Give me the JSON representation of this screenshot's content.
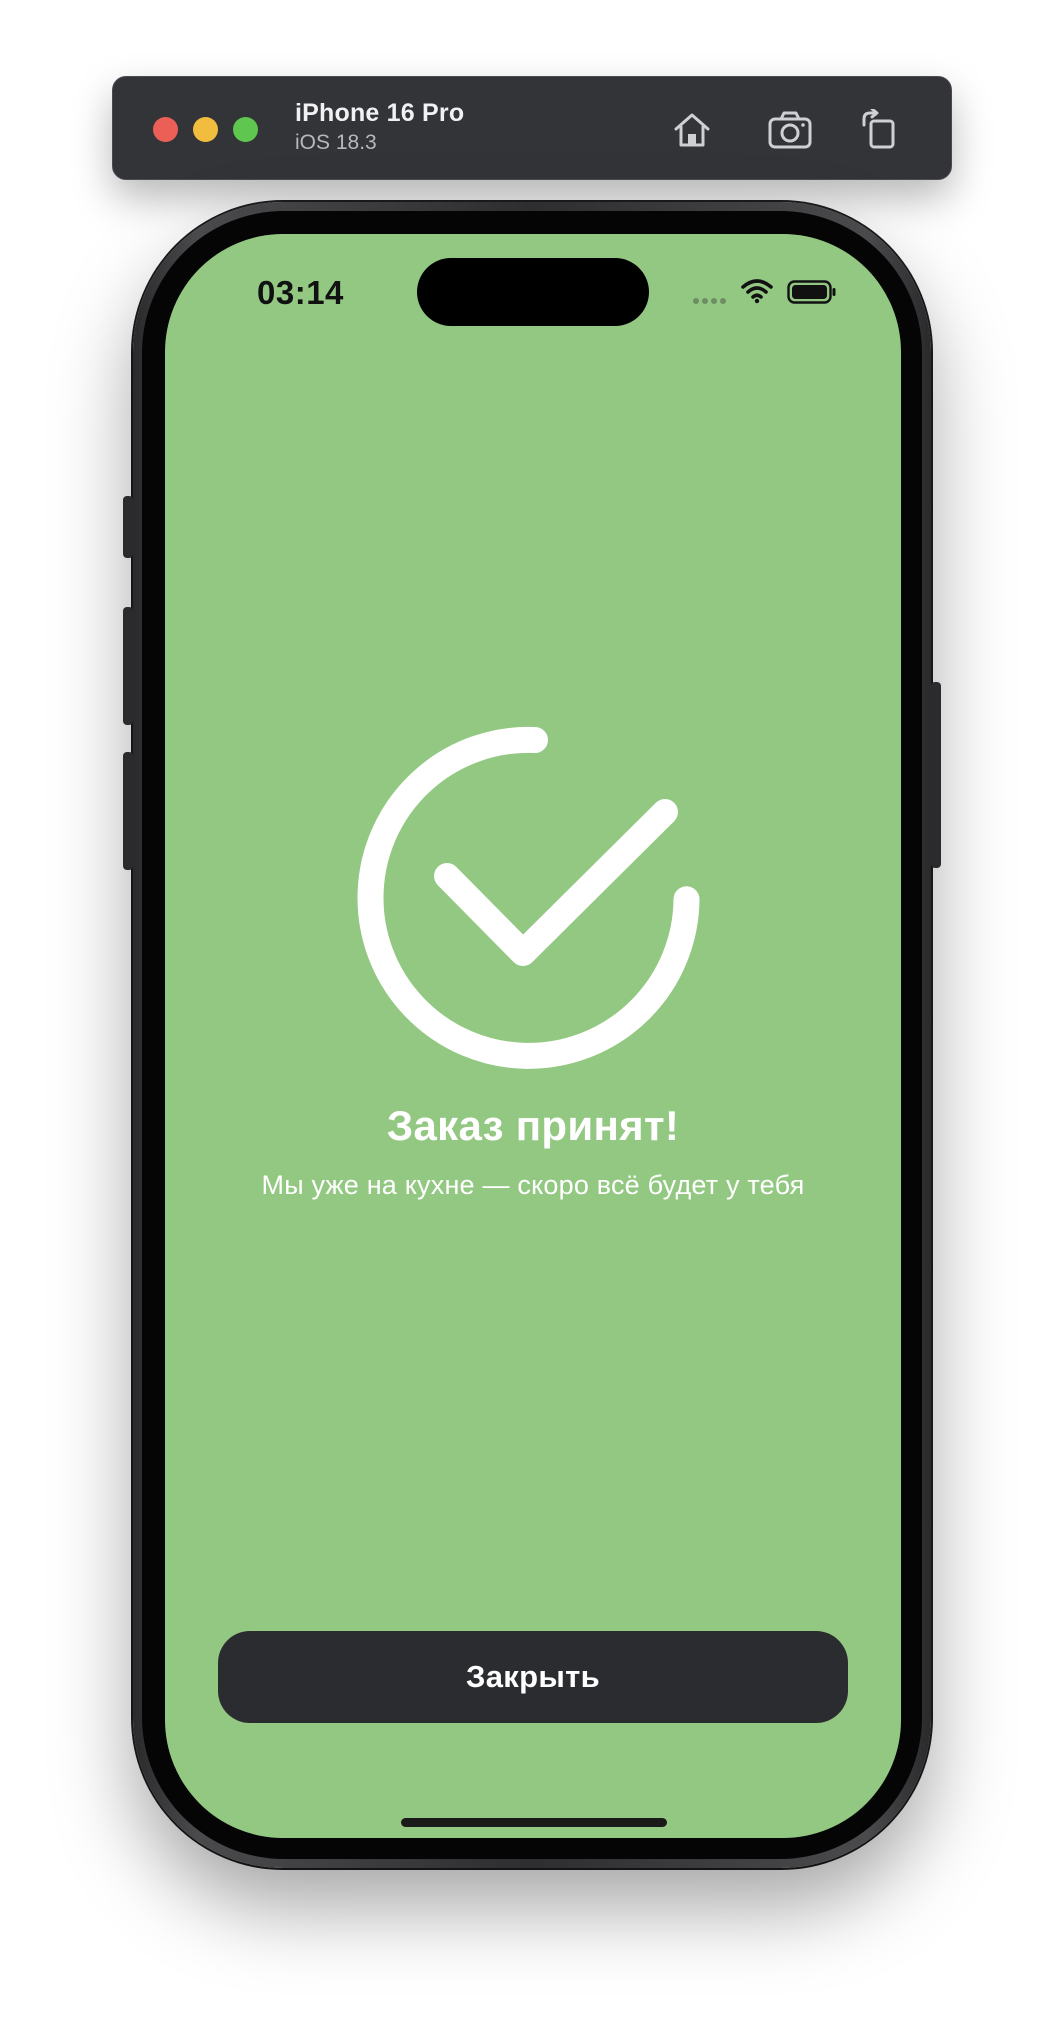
{
  "simulator": {
    "device_name": "iPhone 16 Pro",
    "os_version": "iOS 18.3",
    "buttons": [
      {
        "icon": "home-icon"
      },
      {
        "icon": "camera-screenshot-icon"
      },
      {
        "icon": "rotate-icon"
      }
    ]
  },
  "status_bar": {
    "time": "03:14",
    "icons": [
      "cellular-signal-icon",
      "wifi-icon",
      "battery-icon"
    ]
  },
  "confirmation": {
    "icon": "checkmark-circle-icon",
    "title": "Заказ принят!",
    "subtitle": "Мы уже на кухне — скоро всё будет у тебя"
  },
  "actions": {
    "close_label": "Закрыть"
  },
  "colors": {
    "screen_background": "#93c882",
    "button_background": "#2b2c30",
    "text": "#ffffff"
  }
}
